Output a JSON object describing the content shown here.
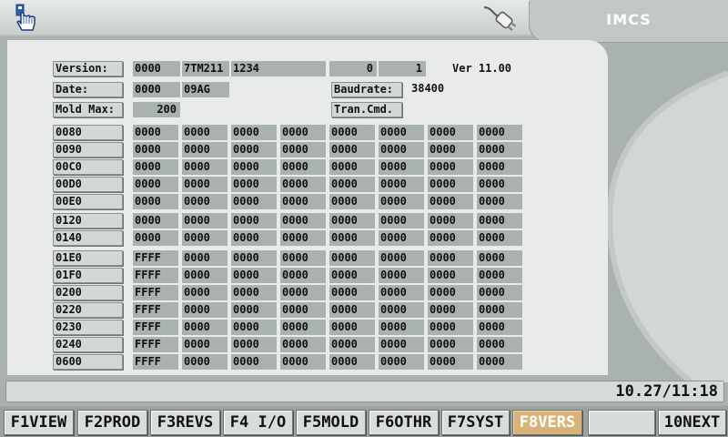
{
  "header": {
    "title": "IMCS",
    "left_icon": "hand-pointer-icon",
    "right_icon": "plug-icon"
  },
  "info": {
    "version_label": "Version:",
    "version_values": [
      "0000",
      "7TM211",
      "1234",
      "0",
      "1"
    ],
    "version_text": "Ver 11.00",
    "date_label": "Date:",
    "date_values": [
      "0000",
      "09AG"
    ],
    "baudrate_label": "Baudrate:",
    "baudrate_value": "38400",
    "moldmax_label": "Mold Max:",
    "moldmax_value": "200",
    "trancmd_label": "Tran.Cmd."
  },
  "rows": [
    {
      "addr": "0080",
      "vals": [
        "0000",
        "0000",
        "0000",
        "0000",
        "0000",
        "0000",
        "0000",
        "0000"
      ]
    },
    {
      "addr": "0090",
      "vals": [
        "0000",
        "0000",
        "0000",
        "0000",
        "0000",
        "0000",
        "0000",
        "0000"
      ]
    },
    {
      "addr": "00C0",
      "vals": [
        "0000",
        "0000",
        "0000",
        "0000",
        "0000",
        "0000",
        "0000",
        "0000"
      ]
    },
    {
      "addr": "00D0",
      "vals": [
        "0000",
        "0000",
        "0000",
        "0000",
        "0000",
        "0000",
        "0000",
        "0000"
      ]
    },
    {
      "addr": "00E0",
      "vals": [
        "0000",
        "0000",
        "0000",
        "0000",
        "0000",
        "0000",
        "0000",
        "0000"
      ]
    },
    {
      "addr": "0120",
      "vals": [
        "0000",
        "0000",
        "0000",
        "0000",
        "0000",
        "0000",
        "0000",
        "0000"
      ]
    },
    {
      "addr": "0140",
      "vals": [
        "0000",
        "0000",
        "0000",
        "0000",
        "0000",
        "0000",
        "0000",
        "0000"
      ]
    },
    {
      "addr": "01E0",
      "vals": [
        "FFFF",
        "0000",
        "0000",
        "0000",
        "0000",
        "0000",
        "0000",
        "0000"
      ]
    },
    {
      "addr": "01F0",
      "vals": [
        "FFFF",
        "0000",
        "0000",
        "0000",
        "0000",
        "0000",
        "0000",
        "0000"
      ]
    },
    {
      "addr": "0200",
      "vals": [
        "FFFF",
        "0000",
        "0000",
        "0000",
        "0000",
        "0000",
        "0000",
        "0000"
      ]
    },
    {
      "addr": "0220",
      "vals": [
        "FFFF",
        "0000",
        "0000",
        "0000",
        "0000",
        "0000",
        "0000",
        "0000"
      ]
    },
    {
      "addr": "0230",
      "vals": [
        "FFFF",
        "0000",
        "0000",
        "0000",
        "0000",
        "0000",
        "0000",
        "0000"
      ]
    },
    {
      "addr": "0240",
      "vals": [
        "FFFF",
        "0000",
        "0000",
        "0000",
        "0000",
        "0000",
        "0000",
        "0000"
      ]
    },
    {
      "addr": "0600",
      "vals": [
        "FFFF",
        "0000",
        "0000",
        "0000",
        "0000",
        "0000",
        "0000",
        "0000"
      ]
    }
  ],
  "status": {
    "datetime": "10.27/11:18"
  },
  "fkeys": [
    {
      "label": "F1VIEW",
      "active": false
    },
    {
      "label": "F2PROD",
      "active": false
    },
    {
      "label": "F3REVS",
      "active": false
    },
    {
      "label": "F4 I/O",
      "active": false
    },
    {
      "label": "F5MOLD",
      "active": false
    },
    {
      "label": "F6OTHR",
      "active": false
    },
    {
      "label": "F7SYST",
      "active": false
    },
    {
      "label": "F8VERS",
      "active": true
    },
    {
      "label": "",
      "active": false
    },
    {
      "label": "10NEXT",
      "active": false
    }
  ],
  "colors": {
    "background": "#a9b2ad",
    "panel": "#e9ebea",
    "active_key": "#d9b27a"
  }
}
